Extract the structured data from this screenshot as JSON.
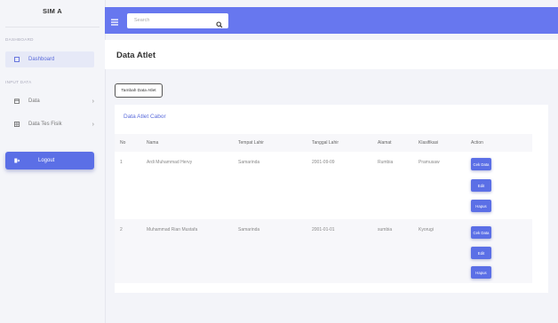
{
  "app": {
    "brand": "SIM A"
  },
  "sidebar": {
    "sections": [
      {
        "label": "DASHBOARD"
      },
      {
        "label": "INPUT DATA"
      }
    ],
    "items": [
      {
        "label": "Dashboard",
        "icon": "dashboard-icon",
        "active": true
      },
      {
        "label": "Data",
        "icon": "calendar-icon",
        "chevron": "›"
      },
      {
        "label": "Data Tes Fisik",
        "icon": "grid-icon",
        "chevron": "›"
      }
    ],
    "logout": {
      "label": "Logout",
      "icon": "logout-icon"
    }
  },
  "topbar": {
    "search_placeholder": "Search",
    "accent": "#6777ef"
  },
  "page": {
    "title": "Data Atlet",
    "add_button": "Tambah Data Atlet"
  },
  "table": {
    "card_title": "Data Atlet Cabor",
    "headers": [
      "No",
      "Nama",
      "Tempat Lahir",
      "Tanggal Lahir",
      "Alamat",
      "Klasifikasi",
      "Action"
    ],
    "rows": [
      {
        "no": "1",
        "nama": "Ardi Muhammad Hervy",
        "tempat": "Samarinda",
        "tanggal": "2001-09-09",
        "alamat": "Rumbia",
        "klasifikasi": "Pramusaw"
      },
      {
        "no": "2",
        "nama": "Muhammad Rian Mustafa",
        "tempat": "Samarinda",
        "tanggal": "2001-01-01",
        "alamat": "sumbia",
        "klasifikasi": "Kyorugi"
      }
    ],
    "actions": {
      "cek": "Cek Data",
      "edit": "Edit",
      "hapus": "Hapus"
    }
  }
}
